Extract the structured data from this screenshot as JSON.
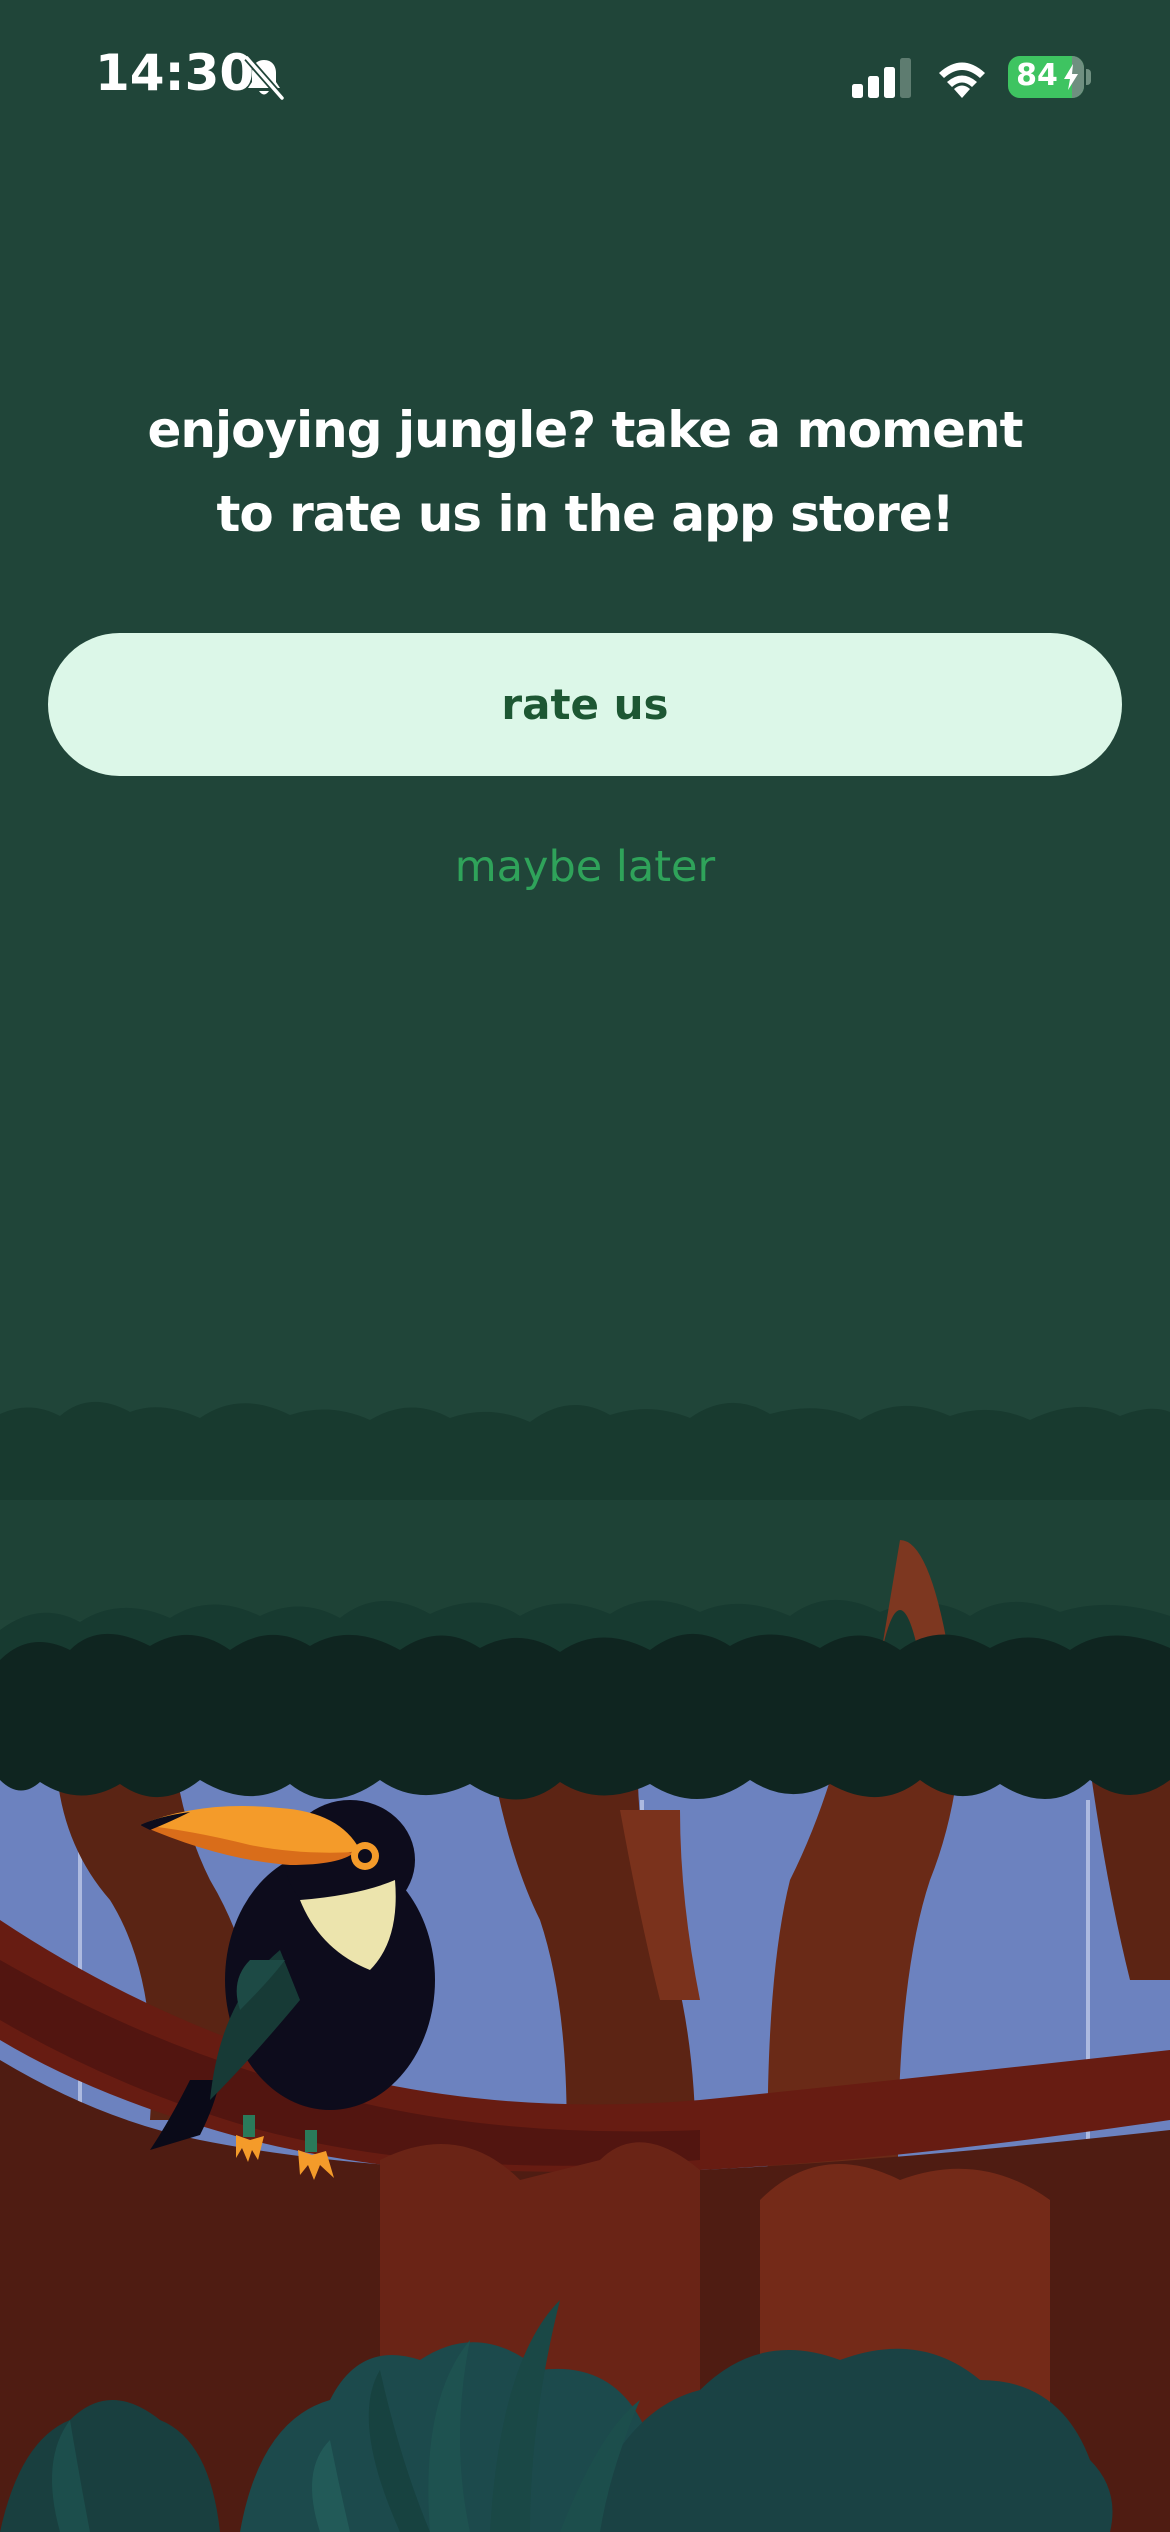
{
  "status_bar": {
    "time": "14:30",
    "battery_percent": "84",
    "icons": [
      "bell-slash-icon",
      "signal-icon",
      "wifi-icon",
      "battery-icon",
      "bolt-icon"
    ]
  },
  "prompt": {
    "line1": "enjoying jungle? take a moment",
    "line2": "to rate us in the app store!"
  },
  "actions": {
    "rate_label": "rate us",
    "later_label": "maybe later"
  },
  "colors": {
    "background": "#204539",
    "button_bg": "#dcf7e8",
    "button_text": "#1d5733",
    "link_text": "#2fa35a",
    "battery": "#3ec461"
  },
  "illustration": {
    "subject": "toucan-on-branch-jungle"
  }
}
